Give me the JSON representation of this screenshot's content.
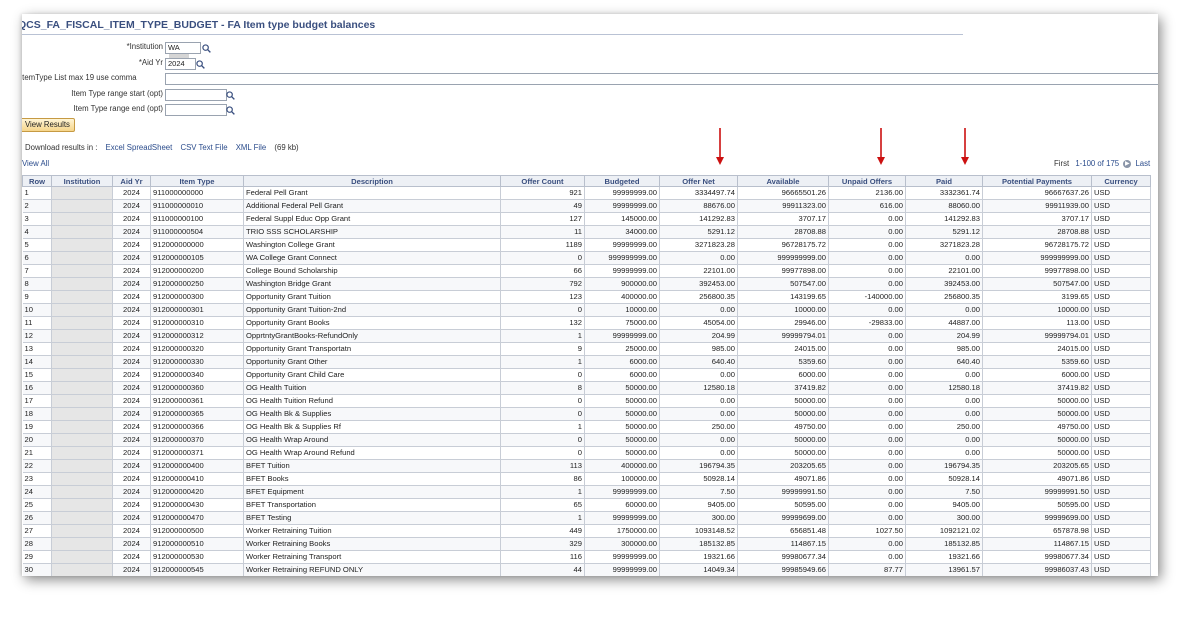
{
  "page": {
    "title": "QCS_FA_FISCAL_ITEM_TYPE_BUDGET - FA Item type budget balances"
  },
  "form": {
    "institution_label": "*Institution",
    "institution_value": "WA",
    "aid_yr_label": "*Aid Yr",
    "aid_yr_value": "2024",
    "itemtype_list_label": "ItemType List max 19 use comma",
    "range_start_label": "Item Type range start (opt)",
    "range_end_label": "Item Type range end (opt)",
    "view_results_label": "View Results"
  },
  "download": {
    "prefix": "Download results in :",
    "excel": "Excel SpreadSheet",
    "csv": "CSV Text File",
    "xml": "XML File",
    "size": "(69 kb)"
  },
  "grid_nav": {
    "view_all": "View All",
    "first": "First",
    "range": "1-100 of 175",
    "last": "Last"
  },
  "colors": {
    "title": "#3a4f7f",
    "link": "#2b4c8c",
    "arrow": "#cc1111",
    "header_bg": "#edf0f5"
  },
  "table": {
    "columns": [
      "Row",
      "Institution",
      "Aid Yr",
      "Item Type",
      "Description",
      "Offer Count",
      "Budgeted",
      "Offer Net",
      "Available",
      "Unpaid Offers",
      "Paid",
      "Potential Payments",
      "Currency"
    ],
    "rows": [
      [
        "1",
        "",
        "2024",
        "911000000000",
        "Federal Pell Grant",
        "921",
        "99999999.00",
        "3334497.74",
        "96665501.26",
        "2136.00",
        "3332361.74",
        "96667637.26",
        "USD"
      ],
      [
        "2",
        "",
        "2024",
        "911000000010",
        "Additional Federal Pell Grant",
        "49",
        "99999999.00",
        "88676.00",
        "99911323.00",
        "616.00",
        "88060.00",
        "99911939.00",
        "USD"
      ],
      [
        "3",
        "",
        "2024",
        "911000000100",
        "Federal Suppl Educ Opp Grant",
        "127",
        "145000.00",
        "141292.83",
        "3707.17",
        "0.00",
        "141292.83",
        "3707.17",
        "USD"
      ],
      [
        "4",
        "",
        "2024",
        "911000000504",
        "TRIO SSS SCHOLARSHIP",
        "11",
        "34000.00",
        "5291.12",
        "28708.88",
        "0.00",
        "5291.12",
        "28708.88",
        "USD"
      ],
      [
        "5",
        "",
        "2024",
        "912000000000",
        "Washington College Grant",
        "1189",
        "99999999.00",
        "3271823.28",
        "96728175.72",
        "0.00",
        "3271823.28",
        "96728175.72",
        "USD"
      ],
      [
        "6",
        "",
        "2024",
        "912000000105",
        "WA College Grant Connect",
        "0",
        "999999999.00",
        "0.00",
        "999999999.00",
        "0.00",
        "0.00",
        "999999999.00",
        "USD"
      ],
      [
        "7",
        "",
        "2024",
        "912000000200",
        "College Bound Scholarship",
        "66",
        "99999999.00",
        "22101.00",
        "99977898.00",
        "0.00",
        "22101.00",
        "99977898.00",
        "USD"
      ],
      [
        "8",
        "",
        "2024",
        "912000000250",
        "Washington Bridge Grant",
        "792",
        "900000.00",
        "392453.00",
        "507547.00",
        "0.00",
        "392453.00",
        "507547.00",
        "USD"
      ],
      [
        "9",
        "",
        "2024",
        "912000000300",
        "Opportunity Grant Tuition",
        "123",
        "400000.00",
        "256800.35",
        "143199.65",
        "-140000.00",
        "256800.35",
        "3199.65",
        "USD"
      ],
      [
        "10",
        "",
        "2024",
        "912000000301",
        "Opportunity Grant Tuition-2nd",
        "0",
        "10000.00",
        "0.00",
        "10000.00",
        "0.00",
        "0.00",
        "10000.00",
        "USD"
      ],
      [
        "11",
        "",
        "2024",
        "912000000310",
        "Opportunity Grant Books",
        "132",
        "75000.00",
        "45054.00",
        "29946.00",
        "-29833.00",
        "44887.00",
        "113.00",
        "USD"
      ],
      [
        "12",
        "",
        "2024",
        "912000000312",
        "OpprtntyGrantBooks-RefundOnly",
        "1",
        "99999999.00",
        "204.99",
        "99999794.01",
        "0.00",
        "204.99",
        "99999794.01",
        "USD"
      ],
      [
        "13",
        "",
        "2024",
        "912000000320",
        "Opportunity Grant Transportatn",
        "9",
        "25000.00",
        "985.00",
        "24015.00",
        "0.00",
        "985.00",
        "24015.00",
        "USD"
      ],
      [
        "14",
        "",
        "2024",
        "912000000330",
        "Opportunity Grant Other",
        "1",
        "6000.00",
        "640.40",
        "5359.60",
        "0.00",
        "640.40",
        "5359.60",
        "USD"
      ],
      [
        "15",
        "",
        "2024",
        "912000000340",
        "Opportunity Grant Child Care",
        "0",
        "6000.00",
        "0.00",
        "6000.00",
        "0.00",
        "0.00",
        "6000.00",
        "USD"
      ],
      [
        "16",
        "",
        "2024",
        "912000000360",
        "OG Health Tuition",
        "8",
        "50000.00",
        "12580.18",
        "37419.82",
        "0.00",
        "12580.18",
        "37419.82",
        "USD"
      ],
      [
        "17",
        "",
        "2024",
        "912000000361",
        "OG Health Tuition Refund",
        "0",
        "50000.00",
        "0.00",
        "50000.00",
        "0.00",
        "0.00",
        "50000.00",
        "USD"
      ],
      [
        "18",
        "",
        "2024",
        "912000000365",
        "OG Health Bk & Supplies",
        "0",
        "50000.00",
        "0.00",
        "50000.00",
        "0.00",
        "0.00",
        "50000.00",
        "USD"
      ],
      [
        "19",
        "",
        "2024",
        "912000000366",
        "OG Health Bk & Supplies Rf",
        "1",
        "50000.00",
        "250.00",
        "49750.00",
        "0.00",
        "250.00",
        "49750.00",
        "USD"
      ],
      [
        "20",
        "",
        "2024",
        "912000000370",
        "OG Health Wrap Around",
        "0",
        "50000.00",
        "0.00",
        "50000.00",
        "0.00",
        "0.00",
        "50000.00",
        "USD"
      ],
      [
        "21",
        "",
        "2024",
        "912000000371",
        "OG Health Wrap Around Refund",
        "0",
        "50000.00",
        "0.00",
        "50000.00",
        "0.00",
        "0.00",
        "50000.00",
        "USD"
      ],
      [
        "22",
        "",
        "2024",
        "912000000400",
        "BFET Tuition",
        "113",
        "400000.00",
        "196794.35",
        "203205.65",
        "0.00",
        "196794.35",
        "203205.65",
        "USD"
      ],
      [
        "23",
        "",
        "2024",
        "912000000410",
        "BFET Books",
        "86",
        "100000.00",
        "50928.14",
        "49071.86",
        "0.00",
        "50928.14",
        "49071.86",
        "USD"
      ],
      [
        "24",
        "",
        "2024",
        "912000000420",
        "BFET Equipment",
        "1",
        "99999999.00",
        "7.50",
        "99999991.50",
        "0.00",
        "7.50",
        "99999991.50",
        "USD"
      ],
      [
        "25",
        "",
        "2024",
        "912000000430",
        "BFET Transportation",
        "65",
        "60000.00",
        "9405.00",
        "50595.00",
        "0.00",
        "9405.00",
        "50595.00",
        "USD"
      ],
      [
        "26",
        "",
        "2024",
        "912000000470",
        "BFET Testing",
        "1",
        "99999999.00",
        "300.00",
        "99999699.00",
        "0.00",
        "300.00",
        "99999699.00",
        "USD"
      ],
      [
        "27",
        "",
        "2024",
        "912000000500",
        "Worker Retraining Tuition",
        "449",
        "1750000.00",
        "1093148.52",
        "656851.48",
        "1027.50",
        "1092121.02",
        "657878.98",
        "USD"
      ],
      [
        "28",
        "",
        "2024",
        "912000000510",
        "Worker Retraining Books",
        "329",
        "300000.00",
        "185132.85",
        "114867.15",
        "0.00",
        "185132.85",
        "114867.15",
        "USD"
      ],
      [
        "29",
        "",
        "2024",
        "912000000530",
        "Worker Retraining Transport",
        "116",
        "99999999.00",
        "19321.66",
        "99980677.34",
        "0.00",
        "19321.66",
        "99980677.34",
        "USD"
      ],
      [
        "30",
        "",
        "2024",
        "912000000545",
        "Worker Retraining REFUND ONLY",
        "44",
        "99999999.00",
        "14049.34",
        "99985949.66",
        "87.77",
        "13961.57",
        "99986037.43",
        "USD"
      ]
    ]
  }
}
